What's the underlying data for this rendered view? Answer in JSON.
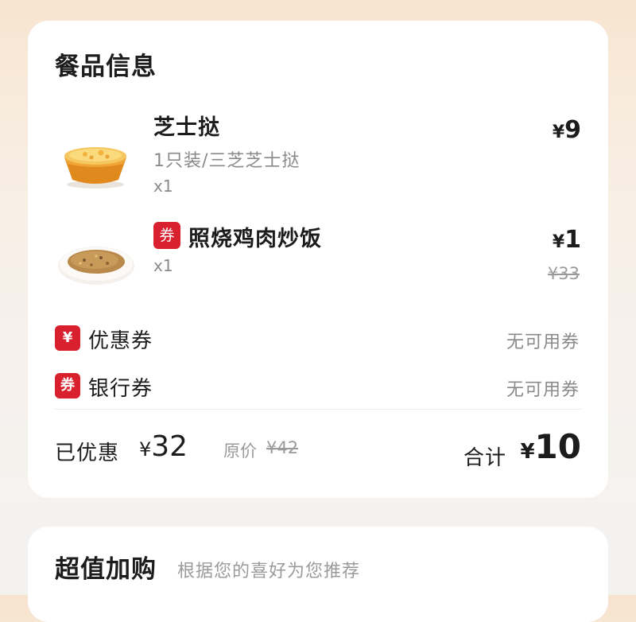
{
  "order": {
    "section_title": "餐品信息",
    "items": [
      {
        "name": "芝士挞",
        "spec": "1只装/三芝芝士挞",
        "qty": "x1",
        "price": "9",
        "image_icon": "cheese-tart-image"
      },
      {
        "name": "照烧鸡肉炒饭",
        "coupon_tag": "券",
        "qty": "x1",
        "price": "1",
        "original_price": "¥33",
        "image_icon": "teriyaki-chicken-fried-rice-image"
      }
    ],
    "currency": "¥",
    "coupons": [
      {
        "icon_text": "¥",
        "label": "优惠券",
        "value": "无可用券"
      },
      {
        "icon_text": "券",
        "label": "银行券",
        "value": "无可用券"
      }
    ],
    "summary": {
      "saved_label": "已优惠",
      "saved_amount": "32",
      "original_label": "原价",
      "original_total": "¥42",
      "total_label": "合计",
      "total_amount": "10"
    }
  },
  "recommend": {
    "title": "超值加购",
    "subtitle": "根据您的喜好为您推荐"
  },
  "colors": {
    "accent_red": "#d8202f",
    "text_primary": "#1c1c1c",
    "text_secondary": "#8a8a8a",
    "background_top": "#f7e4cf"
  }
}
